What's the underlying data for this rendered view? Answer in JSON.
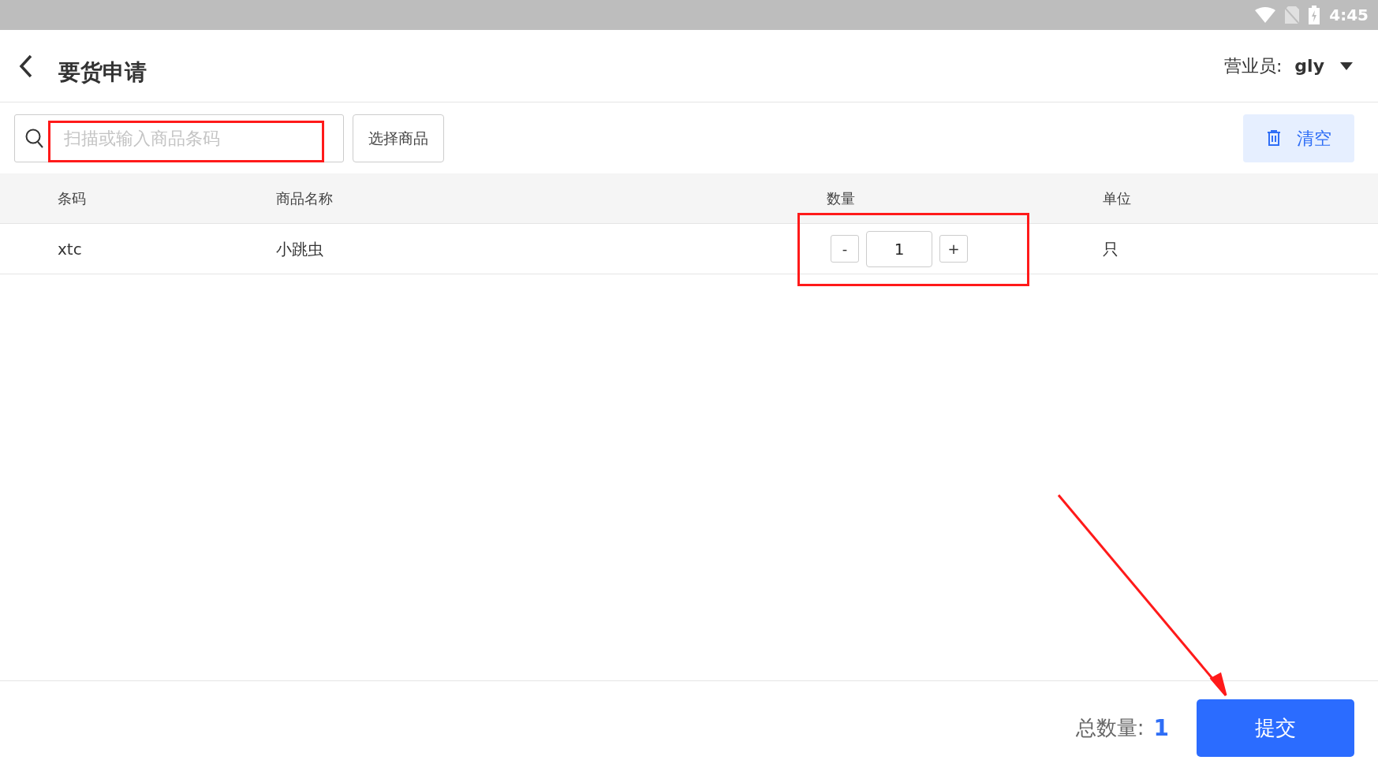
{
  "status_bar": {
    "time": "4:45"
  },
  "header": {
    "title": "要货申请",
    "salesperson_label": "营业员:",
    "salesperson": "gly"
  },
  "toolbar": {
    "search": {
      "placeholder": "扫描或输入商品条码"
    },
    "select_button": "选择商品",
    "clear_button": "清空"
  },
  "table": {
    "columns": [
      "条码",
      "商品名称",
      "数量",
      "单位"
    ],
    "rows": [
      {
        "barcode": "xtc",
        "name": "小跳虫",
        "quantity": "1",
        "decrement": "-",
        "increment": "+",
        "unit": "只"
      }
    ]
  },
  "footer": {
    "total_label": "总数量:",
    "total": "1",
    "submit_button": "提交"
  }
}
